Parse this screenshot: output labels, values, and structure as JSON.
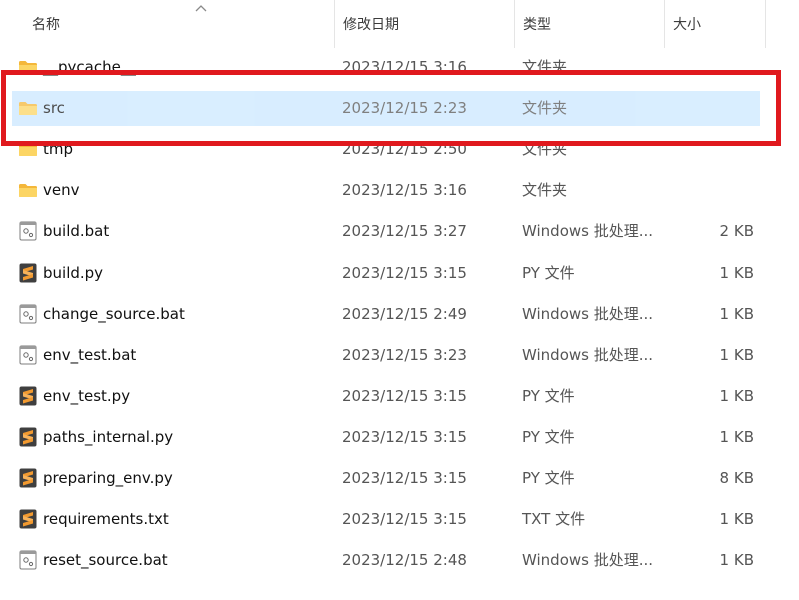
{
  "columns": {
    "name": "名称",
    "date": "修改日期",
    "type": "类型",
    "size": "大小"
  },
  "colors": {
    "selection": "#cce8ff",
    "highlight_border": "#e0191e",
    "folder_yellow": "#f8c94a",
    "sublime_orange": "#f29a30"
  },
  "files": [
    {
      "name": "__pycache__",
      "date": "2023/12/15 3:16",
      "type": "文件夹",
      "size": "",
      "icon": "folder-icon"
    },
    {
      "name": "src",
      "date": "2023/12/15 2:23",
      "type": "文件夹",
      "size": "",
      "icon": "folder-icon",
      "selected": true
    },
    {
      "name": "tmp",
      "date": "2023/12/15 2:50",
      "type": "文件夹",
      "size": "",
      "icon": "folder-icon"
    },
    {
      "name": "venv",
      "date": "2023/12/15 3:16",
      "type": "文件夹",
      "size": "",
      "icon": "folder-icon"
    },
    {
      "name": "build.bat",
      "date": "2023/12/15 3:27",
      "type": "Windows 批处理...",
      "size": "2 KB",
      "icon": "batch-file-icon"
    },
    {
      "name": "build.py",
      "date": "2023/12/15 3:15",
      "type": "PY 文件",
      "size": "1 KB",
      "icon": "sublime-file-icon"
    },
    {
      "name": "change_source.bat",
      "date": "2023/12/15 2:49",
      "type": "Windows 批处理...",
      "size": "1 KB",
      "icon": "batch-file-icon"
    },
    {
      "name": "env_test.bat",
      "date": "2023/12/15 3:23",
      "type": "Windows 批处理...",
      "size": "1 KB",
      "icon": "batch-file-icon"
    },
    {
      "name": "env_test.py",
      "date": "2023/12/15 3:15",
      "type": "PY 文件",
      "size": "1 KB",
      "icon": "sublime-file-icon"
    },
    {
      "name": "paths_internal.py",
      "date": "2023/12/15 3:15",
      "type": "PY 文件",
      "size": "1 KB",
      "icon": "sublime-file-icon"
    },
    {
      "name": "preparing_env.py",
      "date": "2023/12/15 3:15",
      "type": "PY 文件",
      "size": "8 KB",
      "icon": "sublime-file-icon"
    },
    {
      "name": "requirements.txt",
      "date": "2023/12/15 3:15",
      "type": "TXT 文件",
      "size": "1 KB",
      "icon": "sublime-file-icon"
    },
    {
      "name": "reset_source.bat",
      "date": "2023/12/15 2:48",
      "type": "Windows 批处理...",
      "size": "1 KB",
      "icon": "batch-file-icon"
    }
  ]
}
